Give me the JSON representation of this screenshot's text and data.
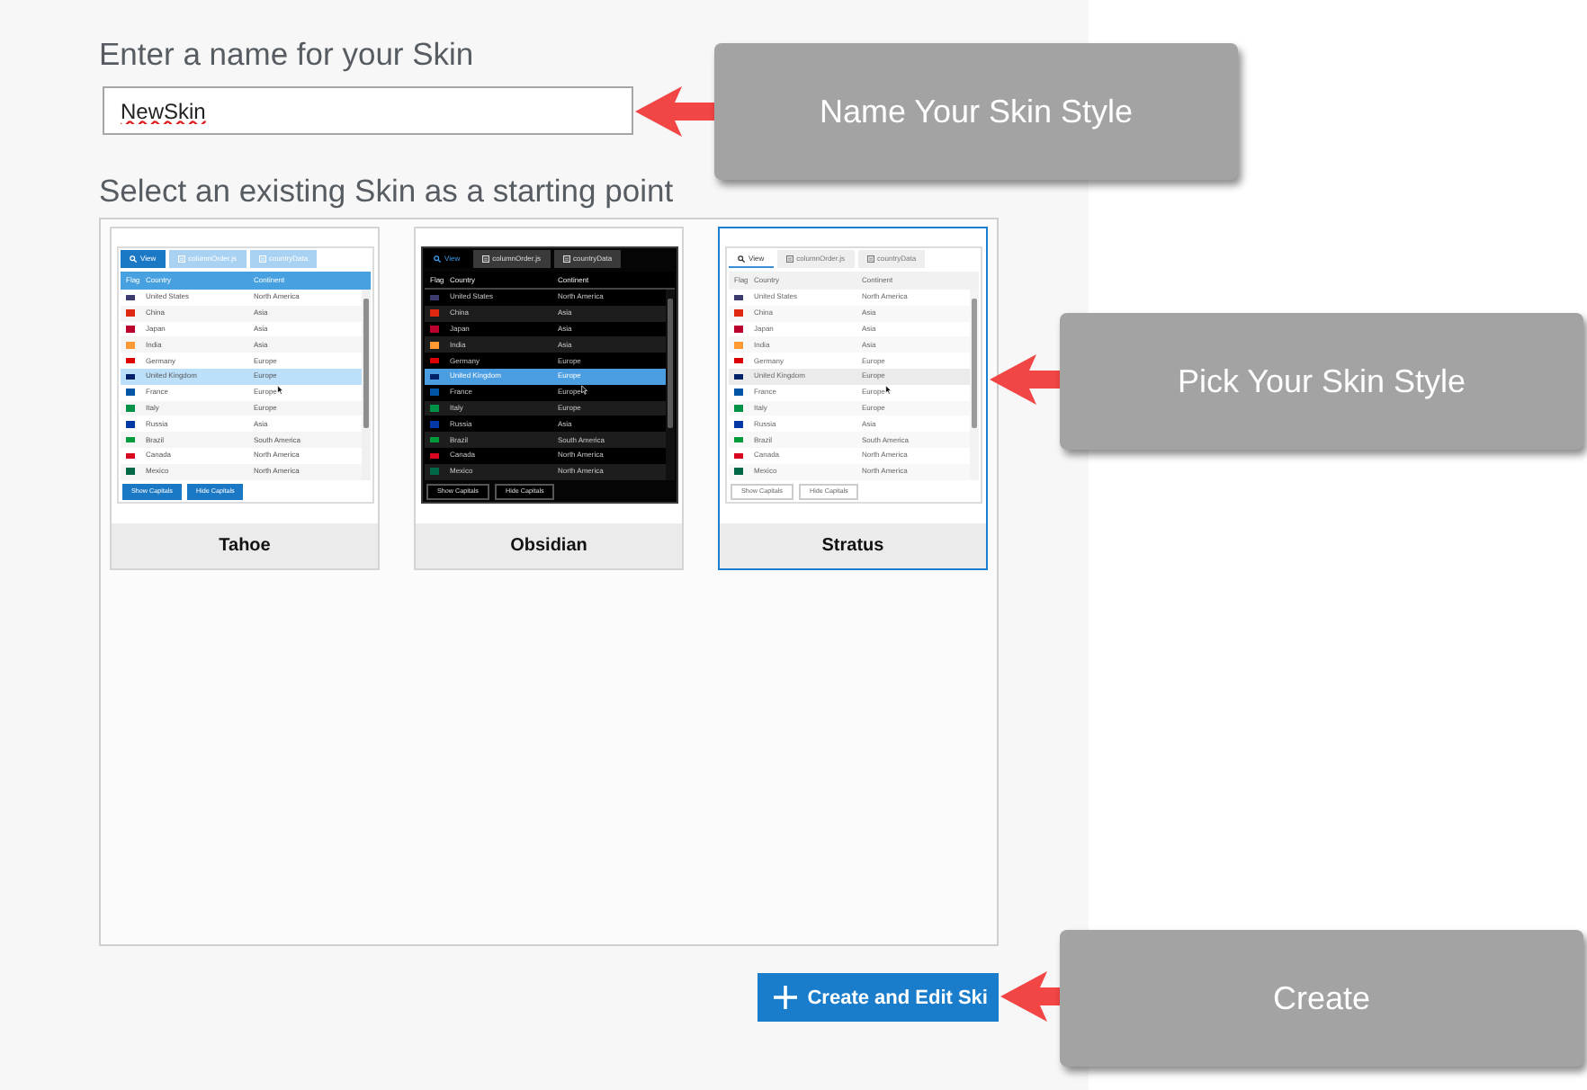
{
  "form": {
    "name_label": "Enter a name for your Skin",
    "name_value": "NewSkin",
    "misspelled": true,
    "skins_label": "Select an existing Skin as a starting point"
  },
  "skins": [
    {
      "name": "Tahoe",
      "kind": "accent",
      "selected": false,
      "preview": {
        "tabs": [
          {
            "label": "View",
            "kind": "search",
            "selected": true
          },
          {
            "label": "columnOrder.js",
            "kind": "file",
            "selected": false
          },
          {
            "label": "countryData",
            "kind": "file",
            "selected": false
          }
        ],
        "columns": [
          "Flag",
          "Country",
          "Continent"
        ],
        "rows": [
          {
            "color": "#3c3b6e",
            "country": "United States",
            "continent": "North America",
            "selected": false
          },
          {
            "color": "#de2910",
            "country": "China",
            "continent": "Asia",
            "selected": false
          },
          {
            "color": "#bc002d",
            "country": "Japan",
            "continent": "Asia",
            "selected": false
          },
          {
            "color": "#ff9933",
            "country": "India",
            "continent": "Asia",
            "selected": false
          },
          {
            "color": "#dd0000",
            "country": "Germany",
            "continent": "Europe",
            "selected": false
          },
          {
            "color": "#012169",
            "country": "United Kingdom",
            "continent": "Europe",
            "selected": true
          },
          {
            "color": "#0055a4",
            "country": "France",
            "continent": "Europe",
            "selected": false
          },
          {
            "color": "#009246",
            "country": "Italy",
            "continent": "Europe",
            "selected": false
          },
          {
            "color": "#0039a6",
            "country": "Russia",
            "continent": "Asia",
            "selected": false
          },
          {
            "color": "#009c3b",
            "country": "Brazil",
            "continent": "South America",
            "selected": false
          },
          {
            "color": "#d80621",
            "country": "Canada",
            "continent": "North America",
            "selected": false
          },
          {
            "color": "#006847",
            "country": "Mexico",
            "continent": "North America",
            "selected": false
          }
        ],
        "buttons": [
          "Show Capitals",
          "Hide Capitals"
        ]
      }
    },
    {
      "name": "Obsidian",
      "kind": "dark",
      "selected": false,
      "preview": {
        "tabs": [
          {
            "label": "View",
            "kind": "search",
            "selected": true
          },
          {
            "label": "columnOrder.js",
            "kind": "file",
            "selected": false
          },
          {
            "label": "countryData",
            "kind": "file",
            "selected": false
          }
        ],
        "columns": [
          "Flag",
          "Country",
          "Continent"
        ],
        "rows": [
          {
            "color": "#3c3b6e",
            "country": "United States",
            "continent": "North America",
            "selected": false
          },
          {
            "color": "#de2910",
            "country": "China",
            "continent": "Asia",
            "selected": false
          },
          {
            "color": "#bc002d",
            "country": "Japan",
            "continent": "Asia",
            "selected": false
          },
          {
            "color": "#ff9933",
            "country": "India",
            "continent": "Asia",
            "selected": false
          },
          {
            "color": "#dd0000",
            "country": "Germany",
            "continent": "Europe",
            "selected": false
          },
          {
            "color": "#012169",
            "country": "United Kingdom",
            "continent": "Europe",
            "selected": true
          },
          {
            "color": "#0055a4",
            "country": "France",
            "continent": "Europe",
            "selected": false
          },
          {
            "color": "#009246",
            "country": "Italy",
            "continent": "Europe",
            "selected": false
          },
          {
            "color": "#0039a6",
            "country": "Russia",
            "continent": "Asia",
            "selected": false
          },
          {
            "color": "#009c3b",
            "country": "Brazil",
            "continent": "South America",
            "selected": false
          },
          {
            "color": "#d80621",
            "country": "Canada",
            "continent": "North America",
            "selected": false
          },
          {
            "color": "#006847",
            "country": "Mexico",
            "continent": "North America",
            "selected": false
          }
        ],
        "buttons": [
          "Show Capitals",
          "Hide Capitals"
        ]
      }
    },
    {
      "name": "Stratus",
      "kind": "light",
      "selected": true,
      "preview": {
        "tabs": [
          {
            "label": "View",
            "kind": "search",
            "selected": true
          },
          {
            "label": "columnOrder.js",
            "kind": "file",
            "selected": false
          },
          {
            "label": "countryData",
            "kind": "file",
            "selected": false
          }
        ],
        "columns": [
          "Flag",
          "Country",
          "Continent"
        ],
        "rows": [
          {
            "color": "#3c3b6e",
            "country": "United States",
            "continent": "North America",
            "selected": false
          },
          {
            "color": "#de2910",
            "country": "China",
            "continent": "Asia",
            "selected": false
          },
          {
            "color": "#bc002d",
            "country": "Japan",
            "continent": "Asia",
            "selected": false
          },
          {
            "color": "#ff9933",
            "country": "India",
            "continent": "Asia",
            "selected": false
          },
          {
            "color": "#dd0000",
            "country": "Germany",
            "continent": "Europe",
            "selected": false
          },
          {
            "color": "#012169",
            "country": "United Kingdom",
            "continent": "Europe",
            "selected": true
          },
          {
            "color": "#0055a4",
            "country": "France",
            "continent": "Europe",
            "selected": false
          },
          {
            "color": "#009246",
            "country": "Italy",
            "continent": "Europe",
            "selected": false
          },
          {
            "color": "#0039a6",
            "country": "Russia",
            "continent": "Asia",
            "selected": false
          },
          {
            "color": "#009c3b",
            "country": "Brazil",
            "continent": "South America",
            "selected": false
          },
          {
            "color": "#d80621",
            "country": "Canada",
            "continent": "North America",
            "selected": false
          },
          {
            "color": "#006847",
            "country": "Mexico",
            "continent": "North America",
            "selected": false
          }
        ],
        "buttons": [
          "Show Capitals",
          "Hide Capitals"
        ]
      }
    }
  ],
  "create_button": {
    "label": "Create and Edit Ski"
  },
  "callouts": [
    {
      "text": "Name Your Skin Style"
    },
    {
      "text": "Pick Your Skin Style"
    },
    {
      "text": "Create"
    }
  ]
}
